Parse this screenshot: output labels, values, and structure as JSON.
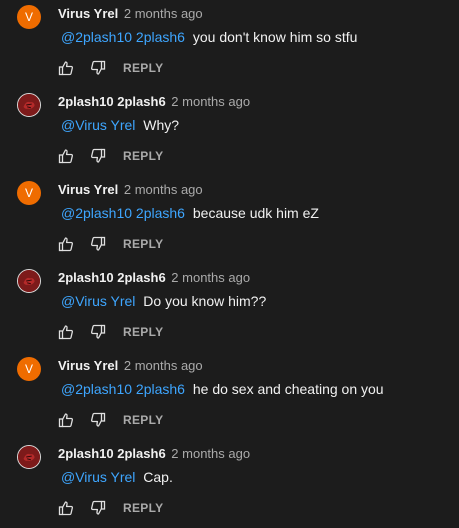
{
  "labels": {
    "reply": "REPLY"
  },
  "colors": {
    "background": "#1c1c1c",
    "mention": "#3ea6ff",
    "avatar_letter_bg": "#ef6c00",
    "avatar_image_bg": "#8a1c1c"
  },
  "icons": {
    "like": "thumbs-up-icon",
    "dislike": "thumbs-down-icon"
  },
  "comments": [
    {
      "author": "Virus Yrel",
      "time": "2 months ago",
      "avatar_letter": "V",
      "mention": "@2plash10 2plash6",
      "text": "you don't know him so stfu"
    },
    {
      "author": "2plash10 2plash6",
      "time": "2 months ago",
      "avatar_letter": "",
      "mention": "@Virus Yrel",
      "text": "Why?"
    },
    {
      "author": "Virus Yrel",
      "time": "2 months ago",
      "avatar_letter": "V",
      "mention": "@2plash10 2plash6",
      "text": "because udk him eZ"
    },
    {
      "author": "2plash10 2plash6",
      "time": "2 months ago",
      "avatar_letter": "",
      "mention": "@Virus Yrel",
      "text": "Do you know him??"
    },
    {
      "author": "Virus Yrel",
      "time": "2 months ago",
      "avatar_letter": "V",
      "mention": "@2plash10 2plash6",
      "text": "he do sex and cheating on you"
    },
    {
      "author": "2plash10 2plash6",
      "time": "2 months ago",
      "avatar_letter": "",
      "mention": "@Virus Yrel",
      "text": "Cap."
    }
  ]
}
